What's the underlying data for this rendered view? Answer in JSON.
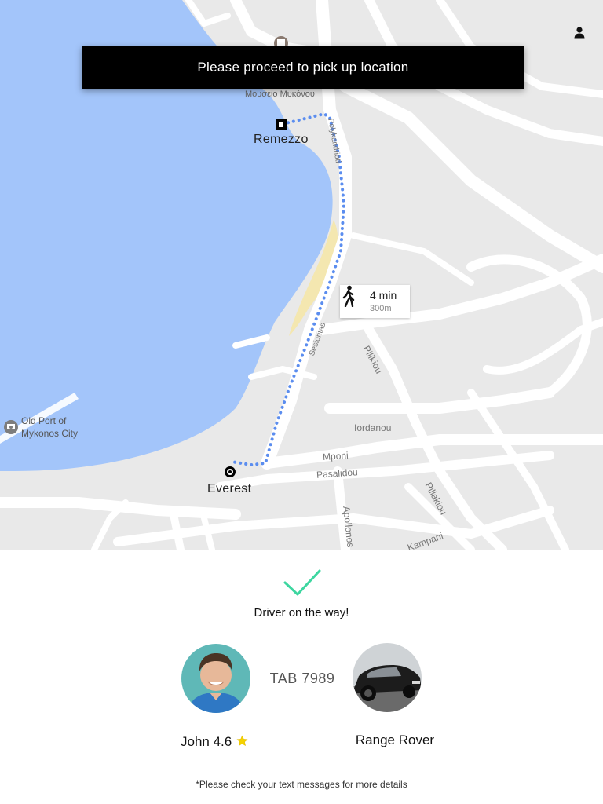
{
  "colors": {
    "water": "#a3c5fa",
    "land": "#e9e9e9",
    "road": "#ffffff",
    "sand": "#f4e7b0",
    "route": "#5b8def",
    "banner_bg": "#000000",
    "check": "#3dd6a0",
    "star": "#f5d200"
  },
  "map": {
    "origin_label": "Remezzo",
    "destination_label": "Everest",
    "poi_label": "Μουσείο Μυκόνου",
    "old_port_label_line1": "Old Port of",
    "old_port_label_line2": "Mykonos City",
    "streets": [
      "Pilikiou",
      "Iordanou",
      "Mponi",
      "Pasalidou",
      "Pillakiou",
      "Apollonos",
      "Kampani",
      "Sesiontas",
      "Polykandrioti"
    ],
    "walk": {
      "time": "4 min",
      "distance": "300m",
      "icon": "walking-person-icon"
    }
  },
  "banner": {
    "text": "Please proceed to pick up location"
  },
  "header": {
    "user_icon": "person-icon"
  },
  "panel": {
    "status_icon": "checkmark-icon",
    "status_text": "Driver on the way!",
    "plate": "TAB 7989",
    "driver_name": "John 4.6",
    "rating_icon": "star-icon",
    "car_name": "Range Rover",
    "note": "*Please check your text messages for more details"
  }
}
